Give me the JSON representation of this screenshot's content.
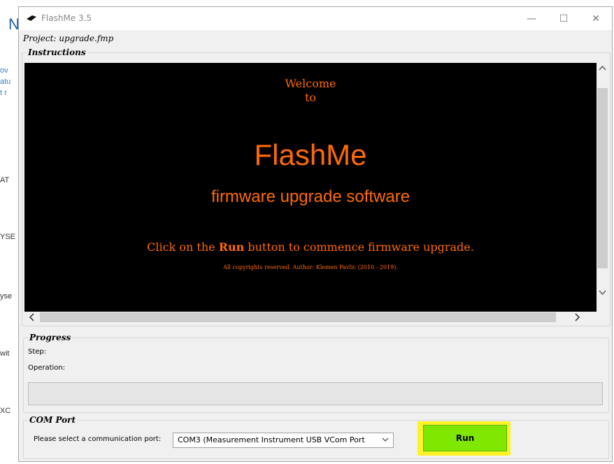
{
  "background_app": {
    "fragments": [
      "ov",
      "atu",
      "t r",
      "AT",
      "YSE",
      "yse",
      "wit",
      "XC"
    ],
    "big_letter": "N"
  },
  "window": {
    "title": "FlashMe 3.5",
    "controls": [
      "—",
      "☐",
      "✕"
    ]
  },
  "project": {
    "label": "Project: upgrade.fmp"
  },
  "instructions": {
    "legend": "Instructions",
    "welcome": "Welcome",
    "to": "to",
    "brand": "FlashMe",
    "subtitle": "firmware upgrade software",
    "click_before": "Click on the ",
    "click_bold": "Run",
    "click_after": " button to commence firmware upgrade.",
    "copyright": "All copyrights reserved. Author: Klemen Pavlic (2010 - 2019).",
    "text_color": "#ff6a00"
  },
  "progress": {
    "legend": "Progress",
    "step_label": "Step:",
    "operation_label": "Operation:",
    "value": 0
  },
  "com_port": {
    "legend": "COM Port",
    "prompt": "Please select a communication port:",
    "selected": "COM3 (Measurement Instrument USB VCom Port",
    "run_label": "Run",
    "run_color": "#80e800",
    "highlight_color": "#fff200"
  }
}
